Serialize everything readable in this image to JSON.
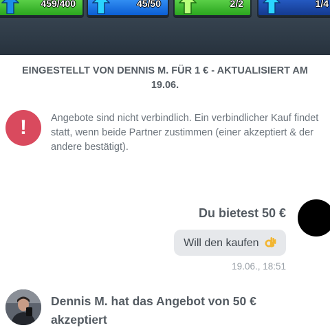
{
  "game_stats": [
    {
      "value": "459/400",
      "color": "green"
    },
    {
      "value": "45/50",
      "color": "blue"
    },
    {
      "value": "2/2",
      "color": "green"
    },
    {
      "value": "1/4",
      "color": "navy"
    }
  ],
  "listing": {
    "info": "EINGESTELLT VON DENNIS M. FÜR 1 € - AKTUALISIERT AM 19.06."
  },
  "notice": {
    "icon": "!",
    "text": "Angebote sind nicht verbindlich. Ein verbindlicher Kauf findet statt, wenn beide Partner zustimmen (einer akzeptiert & der andere bestätigt)."
  },
  "offer": {
    "title": "Du bietest 50 €",
    "message": "Will den kaufen",
    "emoji": "ok-hand-emoji",
    "time": "19.06., 18:51"
  },
  "acceptance": {
    "text": "Dennis M. hat das Angebot von 50 € akzeptiert"
  },
  "colors": {
    "alert": "#d94a5e",
    "bubble": "#e6e8eb",
    "text": "#545b62"
  }
}
